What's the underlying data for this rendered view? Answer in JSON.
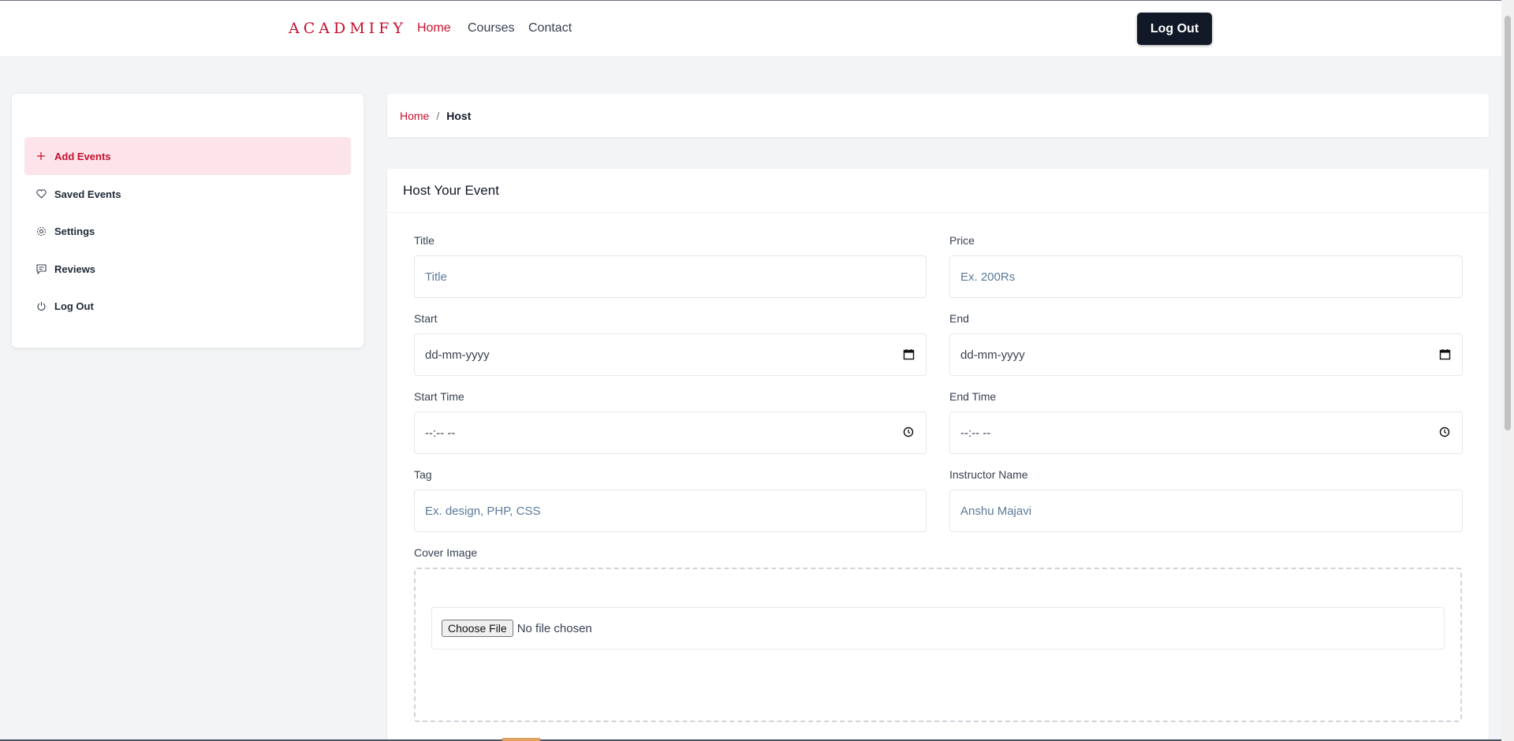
{
  "brand": {
    "logo_text": "ACADMIFY",
    "accent": "#c8102e"
  },
  "nav": {
    "links": [
      {
        "label": "Home",
        "active": true
      },
      {
        "label": "Courses",
        "active": false
      },
      {
        "label": "Contact",
        "active": false
      }
    ],
    "logout_label": "Log Out"
  },
  "sidebar": {
    "items": [
      {
        "label": "Add Events",
        "icon": "plus-icon",
        "active": true
      },
      {
        "label": "Saved Events",
        "icon": "heart-icon",
        "active": false
      },
      {
        "label": "Settings",
        "icon": "gear-icon",
        "active": false
      },
      {
        "label": "Reviews",
        "icon": "comment-icon",
        "active": false
      },
      {
        "label": "Log Out",
        "icon": "power-icon",
        "active": false
      }
    ]
  },
  "breadcrumb": {
    "home": "Home",
    "separator": "/",
    "current": "Host"
  },
  "form": {
    "title": "Host Your Event",
    "fields": {
      "title": {
        "label": "Title",
        "placeholder": "Title"
      },
      "price": {
        "label": "Price",
        "placeholder": "Ex. 200Rs"
      },
      "start": {
        "label": "Start",
        "placeholder": "dd-mm-yyyy"
      },
      "end": {
        "label": "End",
        "placeholder": "dd-mm-yyyy"
      },
      "start_time": {
        "label": "Start Time",
        "placeholder": "--:-- --"
      },
      "end_time": {
        "label": "End Time",
        "placeholder": "--:-- --"
      },
      "tag": {
        "label": "Tag",
        "placeholder": "Ex. design, PHP, CSS"
      },
      "instructor": {
        "label": "Instructor Name",
        "value": "Anshu Majavi"
      }
    },
    "cover": {
      "label": "Cover Image",
      "button": "Choose File",
      "status": "No file chosen"
    }
  }
}
